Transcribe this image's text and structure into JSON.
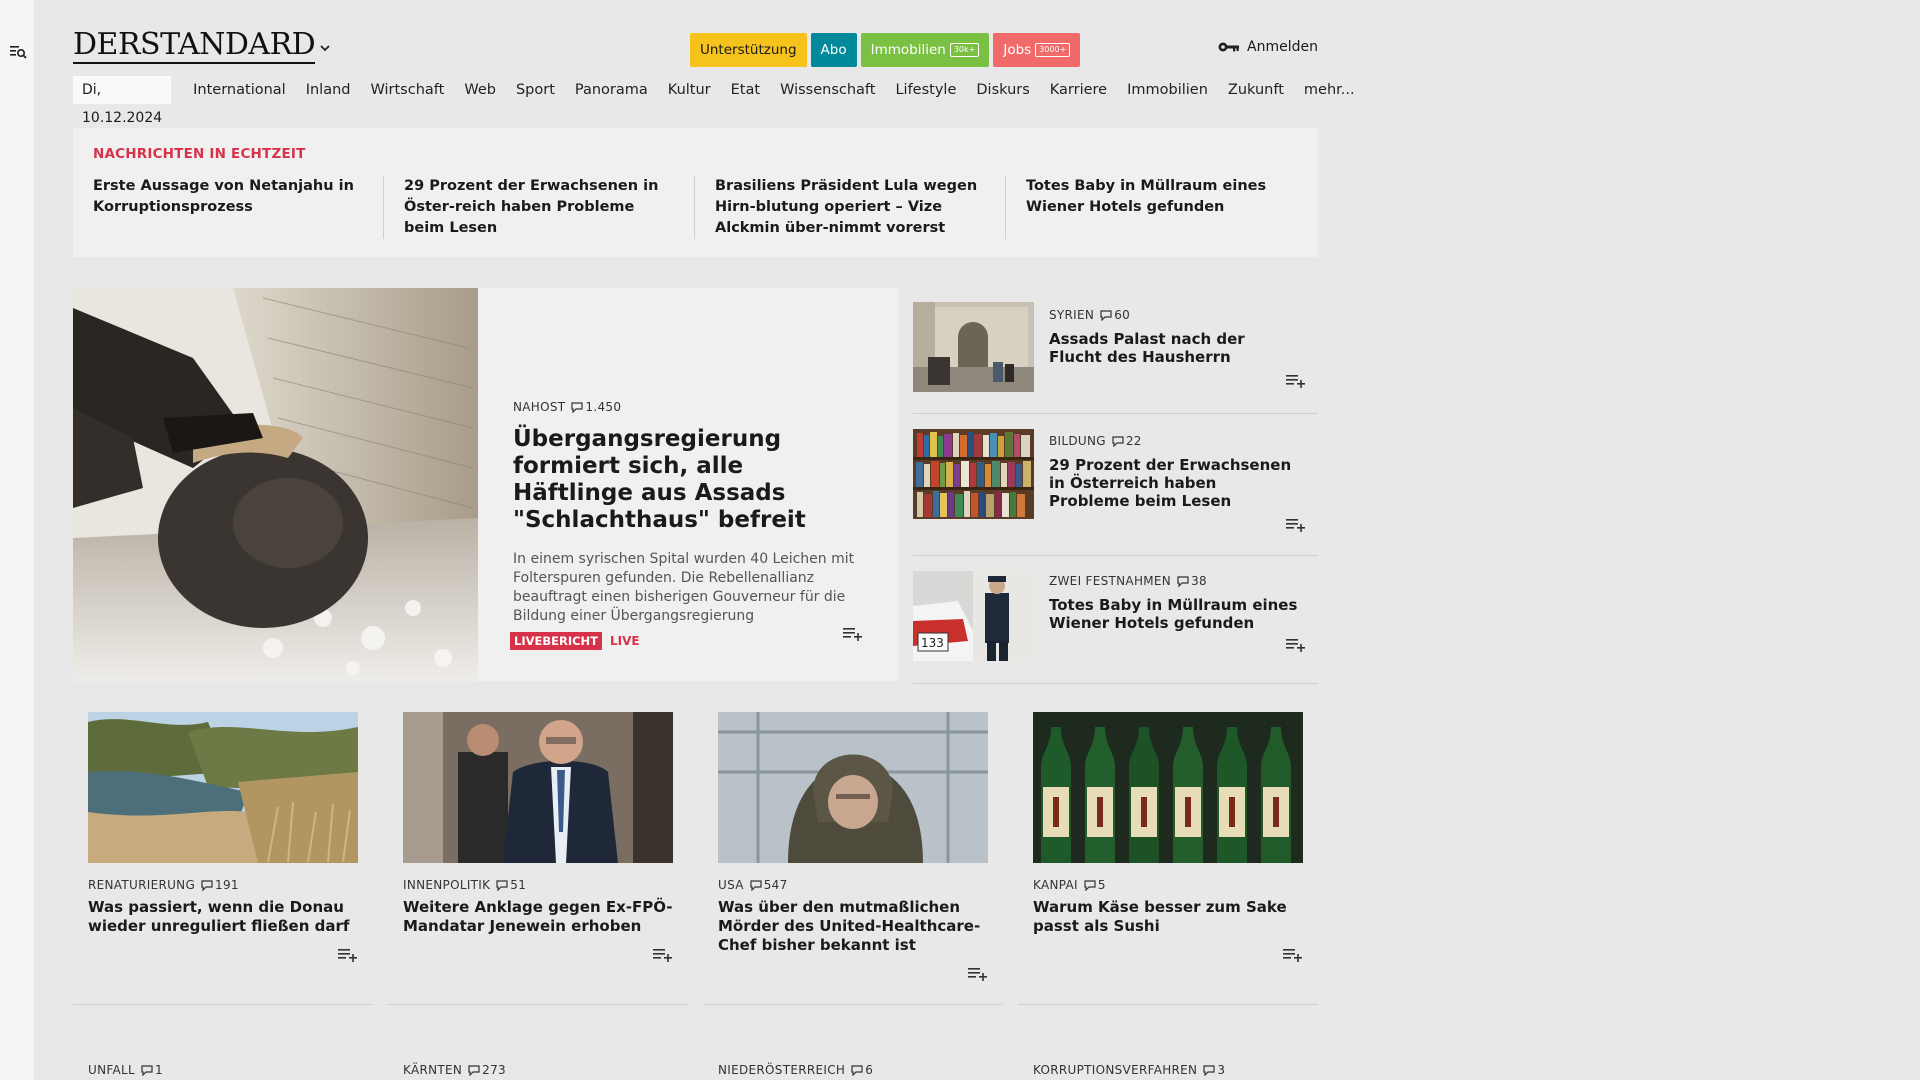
{
  "header": {
    "logo": "DERSTANDARD",
    "pills": [
      {
        "label": "Unterstützung",
        "badge": "",
        "bg": "#f5c31c",
        "fg": "#1a1a1a"
      },
      {
        "label": "Abo",
        "badge": "",
        "bg": "#00899a",
        "fg": "#ffffff"
      },
      {
        "label": "Immobilien",
        "badge": "30k+",
        "bg": "#7ac143",
        "fg": "#ffffff"
      },
      {
        "label": "Jobs",
        "badge": "3000+",
        "bg": "#f06a6a",
        "fg": "#ffffff"
      }
    ],
    "login": "Anmelden"
  },
  "nav": {
    "date": "Di, 10.12.2024",
    "items": [
      "International",
      "Inland",
      "Wirtschaft",
      "Web",
      "Sport",
      "Panorama",
      "Kultur",
      "Etat",
      "Wissenschaft",
      "Lifestyle",
      "Diskurs",
      "Karriere",
      "Immobilien",
      "Zukunft",
      "mehr..."
    ]
  },
  "ticker": {
    "label": "NACHRICHTEN IN ECHTZEIT",
    "items": [
      "Erste Aussage von Netanjahu in Korruptionsprozess",
      "29 Prozent der Erwachsenen in Öster-reich haben Probleme beim Lesen",
      "Brasiliens Präsident Lula wegen Hirn-blutung operiert – Vize Alckmin über-nimmt vorerst",
      "Totes Baby in Müllraum eines Wiener Hotels gefunden"
    ]
  },
  "lead": {
    "kicker": "NAHOST",
    "comments": "1.450",
    "title": "Übergangsregierung formiert sich, alle Häftlinge aus Assads \"Schlachthaus\" befreit",
    "teaser": "In einem syrischen Spital wurden 40 Leichen mit Folterspuren gefunden. Die Rebellenallianz beauftragt einen bisherigen Gouverneur für die Bildung einer Übergangsregierung",
    "live_badge": "LIVEBERICHT",
    "live_text": "LIVE"
  },
  "side": [
    {
      "kicker": "SYRIEN",
      "comments": "60",
      "title": "Assads Palast nach der Flucht des Hausherrn"
    },
    {
      "kicker": "BILDUNG",
      "comments": "22",
      "title": "29 Prozent der Erwachsenen in Österreich haben Probleme beim Lesen"
    },
    {
      "kicker": "ZWEI FESTNAHMEN",
      "comments": "38",
      "title": "Totes Baby in Müllraum eines Wiener Hotels gefunden"
    }
  ],
  "cards": [
    {
      "kicker": "RENATURIERUNG",
      "comments": "191",
      "title": "Was passiert, wenn die Donau wieder unreguliert fließen darf"
    },
    {
      "kicker": "INNENPOLITIK",
      "comments": "51",
      "title": "Weitere Anklage gegen Ex-FPÖ-Mandatar Jenewein erhoben"
    },
    {
      "kicker": "USA",
      "comments": "547",
      "title": "Was über den mutmaßlichen Mörder des United-Healthcare-Chef bisher bekannt ist"
    },
    {
      "kicker": "KANPAI",
      "comments": "5",
      "title": "Warum Käse besser zum Sake passt als Sushi"
    }
  ],
  "bottom": [
    {
      "kicker": "UNFALL",
      "comments": "1"
    },
    {
      "kicker": "KÄRNTEN",
      "comments": "273"
    },
    {
      "kicker": "NIEDERÖSTERREICH",
      "comments": "6"
    },
    {
      "kicker": "KORRUPTIONSVERFAHREN",
      "comments": "3"
    }
  ]
}
